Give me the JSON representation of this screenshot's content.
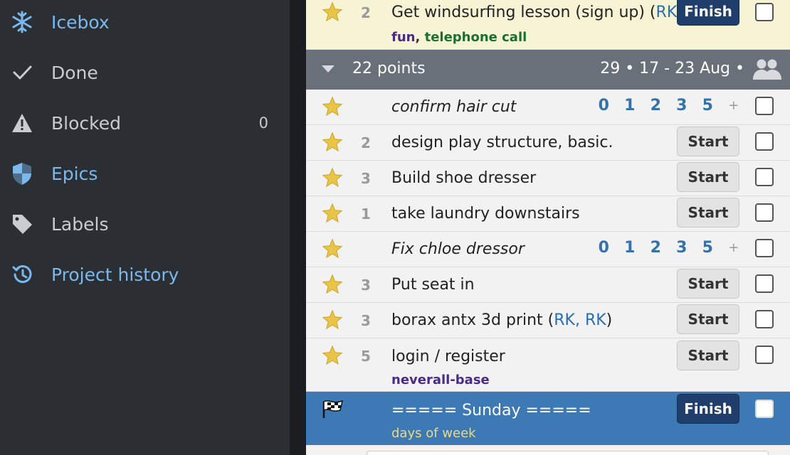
{
  "sidebar": {
    "items": [
      {
        "label": "Icebox",
        "icon": "snowflake-icon",
        "style": "blue"
      },
      {
        "label": "Done",
        "icon": "checkmark-icon",
        "style": "grey"
      },
      {
        "label": "Blocked",
        "icon": "warning-icon",
        "style": "grey",
        "count": "0"
      },
      {
        "label": "Epics",
        "icon": "shield-icon",
        "style": "blue"
      },
      {
        "label": "Labels",
        "icon": "tag-icon",
        "style": "grey"
      },
      {
        "label": "Project history",
        "icon": "history-icon",
        "style": "blue"
      }
    ]
  },
  "top_story": {
    "points": "2",
    "title_prefix": "Get windsurfing lesson (sign up) (",
    "owner": "RK",
    "title_suffix": ")",
    "button": "Finish",
    "label_1": "fun",
    "label_sep": ",",
    "label_2": "telephone call"
  },
  "iteration": {
    "points": "22 points",
    "dates": "29 • 17 - 23 Aug •"
  },
  "stories": [
    {
      "points": "",
      "title": "confirm hair cut",
      "unestimated": true
    },
    {
      "points": "2",
      "title": "design play structure, basic.",
      "button": "Start"
    },
    {
      "points": "3",
      "title": "Build shoe dresser",
      "button": "Start"
    },
    {
      "points": "1",
      "title": "take laundry downstairs",
      "button": "Start"
    },
    {
      "points": "",
      "title": "Fix chloe dressor",
      "unestimated": true
    },
    {
      "points": "3",
      "title": "Put seat in",
      "button": "Start"
    },
    {
      "points": "3",
      "title_prefix": "borax antx 3d print (",
      "owners": "RK, RK",
      "title_suffix": ")",
      "button": "Start"
    },
    {
      "points": "5",
      "title": "login / register",
      "button": "Start",
      "label": "neverall-base"
    }
  ],
  "estimate_options": [
    "0",
    "1",
    "2",
    "3",
    "5",
    "+"
  ],
  "release": {
    "title": "===== Sunday =====",
    "button": "Finish",
    "label": "days of week"
  },
  "colors": {
    "sidebar_bg": "#2b2f33",
    "accent_blue": "#7ab8ee",
    "accepted_bg": "#f7f4d6",
    "release_bg": "#3d7ab5",
    "finish_btn": "#1f3e6b",
    "star": "#e8c547"
  }
}
